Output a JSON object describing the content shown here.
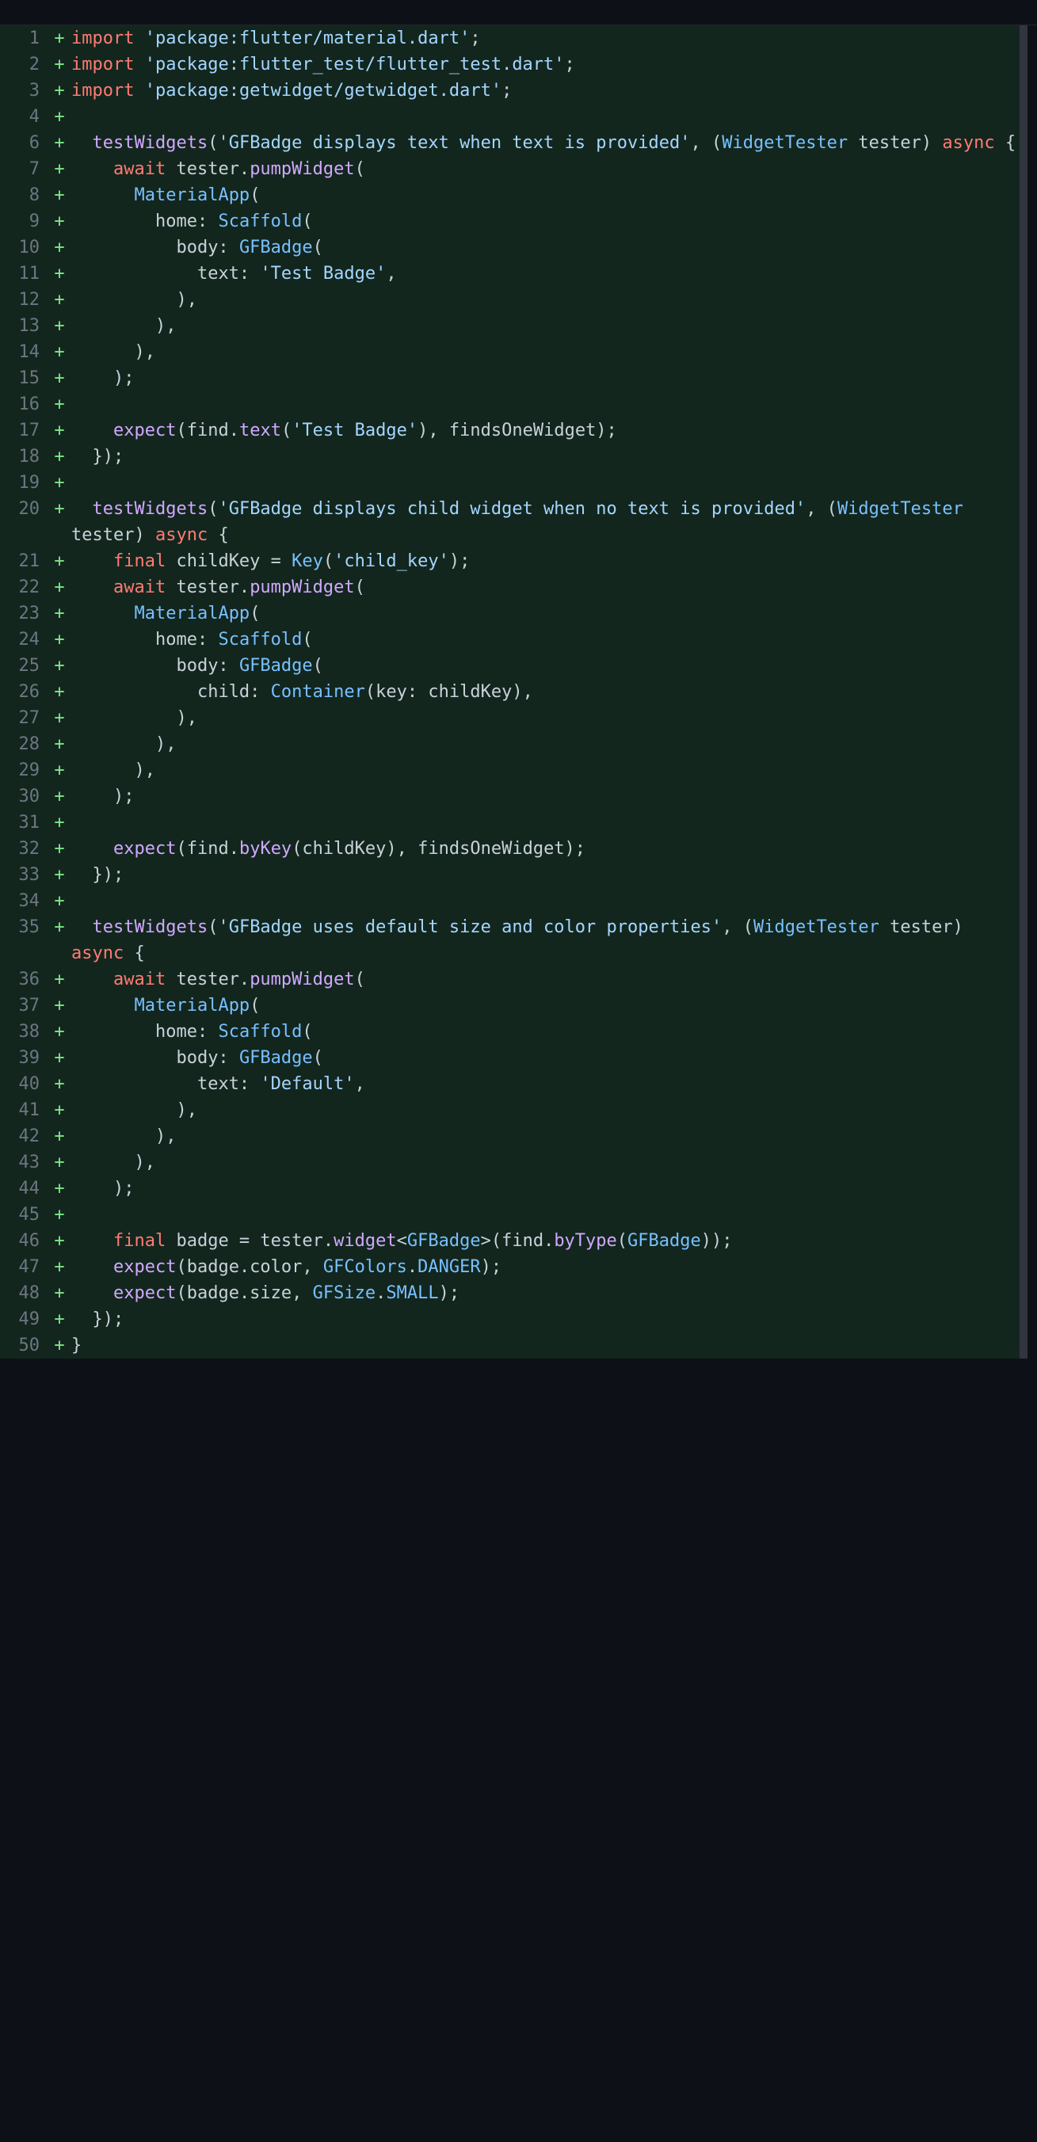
{
  "lines": [
    {
      "n": "1",
      "m": "+",
      "tokens": [
        [
          "keyword",
          "import"
        ],
        [
          "plain",
          " "
        ],
        [
          "string",
          "'package:flutter/material.dart'"
        ],
        [
          "plain",
          ";"
        ]
      ]
    },
    {
      "n": "2",
      "m": "+",
      "tokens": [
        [
          "keyword",
          "import"
        ],
        [
          "plain",
          " "
        ],
        [
          "string",
          "'package:flutter_test/flutter_test.dart'"
        ],
        [
          "plain",
          ";"
        ]
      ]
    },
    {
      "n": "3",
      "m": "+",
      "tokens": [
        [
          "keyword",
          "import"
        ],
        [
          "plain",
          " "
        ],
        [
          "string",
          "'package:getwidget/getwidget.dart'"
        ],
        [
          "plain",
          ";"
        ]
      ]
    },
    {
      "n": "4",
      "m": "+",
      "tokens": []
    },
    {
      "n": "6",
      "m": "+",
      "tokens": [
        [
          "plain",
          "  "
        ],
        [
          "func",
          "testWidgets"
        ],
        [
          "plain",
          "("
        ],
        [
          "string",
          "'GFBadge displays text when text is provided'"
        ],
        [
          "plain",
          ", ("
        ],
        [
          "type",
          "WidgetTester"
        ],
        [
          "plain",
          " tester) "
        ],
        [
          "keyword",
          "async"
        ],
        [
          "plain",
          " {"
        ]
      ]
    },
    {
      "n": "7",
      "m": "+",
      "tokens": [
        [
          "plain",
          "    "
        ],
        [
          "keyword",
          "await"
        ],
        [
          "plain",
          " tester."
        ],
        [
          "func",
          "pumpWidget"
        ],
        [
          "plain",
          "("
        ]
      ]
    },
    {
      "n": "8",
      "m": "+",
      "tokens": [
        [
          "plain",
          "      "
        ],
        [
          "type",
          "MaterialApp"
        ],
        [
          "plain",
          "("
        ]
      ]
    },
    {
      "n": "9",
      "m": "+",
      "tokens": [
        [
          "plain",
          "        home: "
        ],
        [
          "type",
          "Scaffold"
        ],
        [
          "plain",
          "("
        ]
      ]
    },
    {
      "n": "10",
      "m": "+",
      "tokens": [
        [
          "plain",
          "          body: "
        ],
        [
          "type",
          "GFBadge"
        ],
        [
          "plain",
          "("
        ]
      ]
    },
    {
      "n": "11",
      "m": "+",
      "tokens": [
        [
          "plain",
          "            text: "
        ],
        [
          "string",
          "'Test Badge'"
        ],
        [
          "plain",
          ","
        ]
      ]
    },
    {
      "n": "12",
      "m": "+",
      "tokens": [
        [
          "plain",
          "          ),"
        ]
      ]
    },
    {
      "n": "13",
      "m": "+",
      "tokens": [
        [
          "plain",
          "        ),"
        ]
      ]
    },
    {
      "n": "14",
      "m": "+",
      "tokens": [
        [
          "plain",
          "      ),"
        ]
      ]
    },
    {
      "n": "15",
      "m": "+",
      "tokens": [
        [
          "plain",
          "    );"
        ]
      ]
    },
    {
      "n": "16",
      "m": "+",
      "tokens": []
    },
    {
      "n": "17",
      "m": "+",
      "tokens": [
        [
          "plain",
          "    "
        ],
        [
          "func",
          "expect"
        ],
        [
          "plain",
          "(find."
        ],
        [
          "func",
          "text"
        ],
        [
          "plain",
          "("
        ],
        [
          "string",
          "'Test Badge'"
        ],
        [
          "plain",
          "), findsOneWidget);"
        ]
      ]
    },
    {
      "n": "18",
      "m": "+",
      "tokens": [
        [
          "plain",
          "  });"
        ]
      ]
    },
    {
      "n": "19",
      "m": "+",
      "tokens": []
    },
    {
      "n": "20",
      "m": "+",
      "tokens": [
        [
          "plain",
          "  "
        ],
        [
          "func",
          "testWidgets"
        ],
        [
          "plain",
          "("
        ],
        [
          "string",
          "'GFBadge displays child widget when no text is provided'"
        ],
        [
          "plain",
          ", ("
        ],
        [
          "type",
          "WidgetTester"
        ],
        [
          "plain",
          " tester) "
        ],
        [
          "keyword",
          "async"
        ],
        [
          "plain",
          " {"
        ]
      ]
    },
    {
      "n": "21",
      "m": "+",
      "tokens": [
        [
          "plain",
          "    "
        ],
        [
          "keyword",
          "final"
        ],
        [
          "plain",
          " childKey = "
        ],
        [
          "type",
          "Key"
        ],
        [
          "plain",
          "("
        ],
        [
          "string",
          "'child_key'"
        ],
        [
          "plain",
          ");"
        ]
      ]
    },
    {
      "n": "22",
      "m": "+",
      "tokens": [
        [
          "plain",
          "    "
        ],
        [
          "keyword",
          "await"
        ],
        [
          "plain",
          " tester."
        ],
        [
          "func",
          "pumpWidget"
        ],
        [
          "plain",
          "("
        ]
      ]
    },
    {
      "n": "23",
      "m": "+",
      "tokens": [
        [
          "plain",
          "      "
        ],
        [
          "type",
          "MaterialApp"
        ],
        [
          "plain",
          "("
        ]
      ]
    },
    {
      "n": "24",
      "m": "+",
      "tokens": [
        [
          "plain",
          "        home: "
        ],
        [
          "type",
          "Scaffold"
        ],
        [
          "plain",
          "("
        ]
      ]
    },
    {
      "n": "25",
      "m": "+",
      "tokens": [
        [
          "plain",
          "          body: "
        ],
        [
          "type",
          "GFBadge"
        ],
        [
          "plain",
          "("
        ]
      ]
    },
    {
      "n": "26",
      "m": "+",
      "tokens": [
        [
          "plain",
          "            child: "
        ],
        [
          "type",
          "Container"
        ],
        [
          "plain",
          "(key: childKey),"
        ]
      ]
    },
    {
      "n": "27",
      "m": "+",
      "tokens": [
        [
          "plain",
          "          ),"
        ]
      ]
    },
    {
      "n": "28",
      "m": "+",
      "tokens": [
        [
          "plain",
          "        ),"
        ]
      ]
    },
    {
      "n": "29",
      "m": "+",
      "tokens": [
        [
          "plain",
          "      ),"
        ]
      ]
    },
    {
      "n": "30",
      "m": "+",
      "tokens": [
        [
          "plain",
          "    );"
        ]
      ]
    },
    {
      "n": "31",
      "m": "+",
      "tokens": []
    },
    {
      "n": "32",
      "m": "+",
      "tokens": [
        [
          "plain",
          "    "
        ],
        [
          "func",
          "expect"
        ],
        [
          "plain",
          "(find."
        ],
        [
          "func",
          "byKey"
        ],
        [
          "plain",
          "(childKey), findsOneWidget);"
        ]
      ]
    },
    {
      "n": "33",
      "m": "+",
      "tokens": [
        [
          "plain",
          "  });"
        ]
      ]
    },
    {
      "n": "34",
      "m": "+",
      "tokens": []
    },
    {
      "n": "35",
      "m": "+",
      "tokens": [
        [
          "plain",
          "  "
        ],
        [
          "func",
          "testWidgets"
        ],
        [
          "plain",
          "("
        ],
        [
          "string",
          "'GFBadge uses default size and color properties'"
        ],
        [
          "plain",
          ", ("
        ],
        [
          "type",
          "WidgetTester"
        ],
        [
          "plain",
          " tester) "
        ],
        [
          "keyword",
          "async"
        ],
        [
          "plain",
          " {"
        ]
      ]
    },
    {
      "n": "36",
      "m": "+",
      "tokens": [
        [
          "plain",
          "    "
        ],
        [
          "keyword",
          "await"
        ],
        [
          "plain",
          " tester."
        ],
        [
          "func",
          "pumpWidget"
        ],
        [
          "plain",
          "("
        ]
      ]
    },
    {
      "n": "37",
      "m": "+",
      "tokens": [
        [
          "plain",
          "      "
        ],
        [
          "type",
          "MaterialApp"
        ],
        [
          "plain",
          "("
        ]
      ]
    },
    {
      "n": "38",
      "m": "+",
      "tokens": [
        [
          "plain",
          "        home: "
        ],
        [
          "type",
          "Scaffold"
        ],
        [
          "plain",
          "("
        ]
      ]
    },
    {
      "n": "39",
      "m": "+",
      "tokens": [
        [
          "plain",
          "          body: "
        ],
        [
          "type",
          "GFBadge"
        ],
        [
          "plain",
          "("
        ]
      ]
    },
    {
      "n": "40",
      "m": "+",
      "tokens": [
        [
          "plain",
          "            text: "
        ],
        [
          "string",
          "'Default'"
        ],
        [
          "plain",
          ","
        ]
      ]
    },
    {
      "n": "41",
      "m": "+",
      "tokens": [
        [
          "plain",
          "          ),"
        ]
      ]
    },
    {
      "n": "42",
      "m": "+",
      "tokens": [
        [
          "plain",
          "        ),"
        ]
      ]
    },
    {
      "n": "43",
      "m": "+",
      "tokens": [
        [
          "plain",
          "      ),"
        ]
      ]
    },
    {
      "n": "44",
      "m": "+",
      "tokens": [
        [
          "plain",
          "    );"
        ]
      ]
    },
    {
      "n": "45",
      "m": "+",
      "tokens": []
    },
    {
      "n": "46",
      "m": "+",
      "tokens": [
        [
          "plain",
          "    "
        ],
        [
          "keyword",
          "final"
        ],
        [
          "plain",
          " badge = tester."
        ],
        [
          "func",
          "widget"
        ],
        [
          "plain",
          "<"
        ],
        [
          "type",
          "GFBadge"
        ],
        [
          "plain",
          ">(find."
        ],
        [
          "func",
          "byType"
        ],
        [
          "plain",
          "("
        ],
        [
          "type",
          "GFBadge"
        ],
        [
          "plain",
          "));"
        ]
      ]
    },
    {
      "n": "47",
      "m": "+",
      "tokens": [
        [
          "plain",
          "    "
        ],
        [
          "func",
          "expect"
        ],
        [
          "plain",
          "(badge.color, "
        ],
        [
          "type",
          "GFColors"
        ],
        [
          "plain",
          "."
        ],
        [
          "const",
          "DANGER"
        ],
        [
          "plain",
          ");"
        ]
      ]
    },
    {
      "n": "48",
      "m": "+",
      "tokens": [
        [
          "plain",
          "    "
        ],
        [
          "func",
          "expect"
        ],
        [
          "plain",
          "(badge.size, "
        ],
        [
          "type",
          "GFSize"
        ],
        [
          "plain",
          "."
        ],
        [
          "const",
          "SMALL"
        ],
        [
          "plain",
          ");"
        ]
      ]
    },
    {
      "n": "49",
      "m": "+",
      "tokens": [
        [
          "plain",
          "  });"
        ]
      ]
    },
    {
      "n": "50",
      "m": "+",
      "tokens": [
        [
          "plain",
          "}"
        ]
      ]
    }
  ]
}
